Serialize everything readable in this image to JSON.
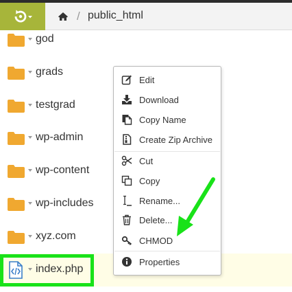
{
  "header": {
    "breadcrumb_dir": "public_html",
    "separator": "/",
    "accent_color": "#a7b53a",
    "home_icon": "home-icon"
  },
  "files": [
    {
      "name": "god",
      "type": "folder"
    },
    {
      "name": "grads",
      "type": "folder"
    },
    {
      "name": "testgrad",
      "type": "folder"
    },
    {
      "name": "wp-admin",
      "type": "folder"
    },
    {
      "name": "wp-content",
      "type": "folder"
    },
    {
      "name": "wp-includes",
      "type": "folder"
    },
    {
      "name": "xyz.com",
      "type": "folder"
    },
    {
      "name": "index.php",
      "type": "code-file"
    }
  ],
  "context_menu": {
    "items": [
      {
        "label": "Edit",
        "icon": "edit-icon"
      },
      {
        "label": "Download",
        "icon": "download-icon"
      },
      {
        "label": "Copy Name",
        "icon": "copy-name-icon"
      },
      {
        "label": "Create Zip Archive",
        "icon": "zip-archive-icon"
      },
      {
        "label": "Cut",
        "icon": "cut-icon"
      },
      {
        "label": "Copy",
        "icon": "copy-icon"
      },
      {
        "label": "Rename...",
        "icon": "rename-icon"
      },
      {
        "label": "Delete...",
        "icon": "trash-icon"
      },
      {
        "label": "CHMOD",
        "icon": "key-icon"
      },
      {
        "label": "Properties",
        "icon": "info-icon"
      }
    ]
  },
  "annotation_color": "#19e219"
}
